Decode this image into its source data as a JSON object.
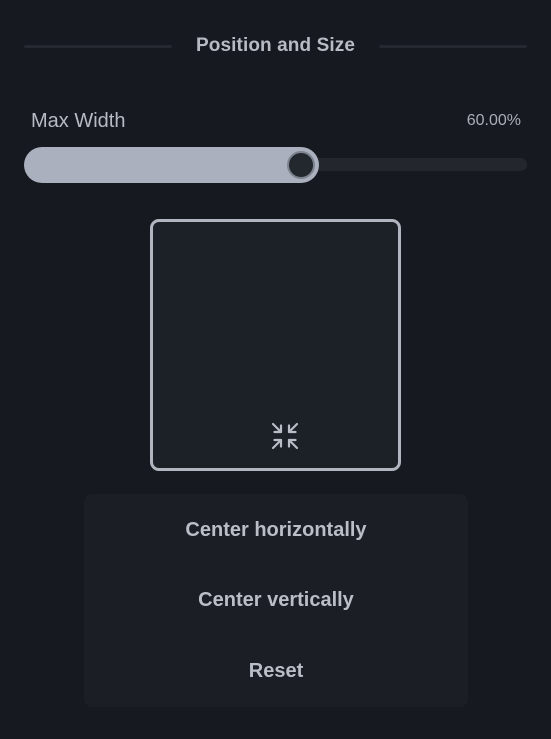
{
  "section": {
    "title": "Position and Size"
  },
  "slider": {
    "label": "Max Width",
    "value_text": "60.00%",
    "value": 0.55
  },
  "preview": {
    "icon": "minimize-icon"
  },
  "actions": [
    {
      "label": "Center horizontally"
    },
    {
      "label": "Center vertically"
    },
    {
      "label": "Reset"
    }
  ],
  "colors": {
    "background": "#16191f",
    "accent": "#aab0bd",
    "text": "#b6bbc4"
  }
}
